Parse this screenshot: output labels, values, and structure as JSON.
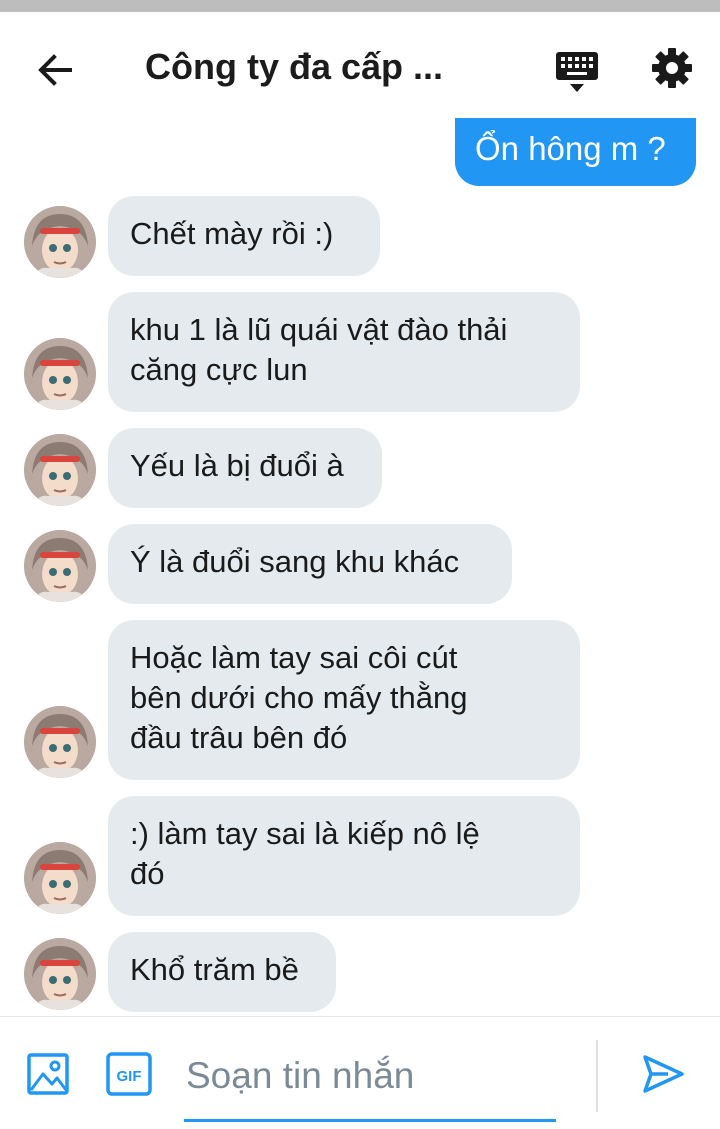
{
  "header": {
    "title": "Công ty đa cấp ...",
    "back_icon": "arrow-left-icon",
    "keyboard_icon": "keyboard-icon",
    "settings_icon": "gear-icon"
  },
  "colors": {
    "accent": "#2196f3",
    "incoming_bubble": "#e4eaee",
    "text": "#1a1a1a",
    "placeholder": "#7b8a96"
  },
  "outgoing_messages": [
    {
      "text": "Ổn hông m ?"
    }
  ],
  "incoming_messages": [
    {
      "lines": [
        "Chết mày rồi :)"
      ]
    },
    {
      "lines": [
        "khu 1 là lũ quái vật đào thải",
        "căng cực lun"
      ]
    },
    {
      "lines": [
        "Yếu là bị đuổi à"
      ]
    },
    {
      "lines": [
        "Ý là đuổi sang khu khác"
      ]
    },
    {
      "lines": [
        "Hoặc làm tay sai côi cút",
        "bên dưới cho mấy thằng",
        "đầu trâu bên đó"
      ]
    },
    {
      "lines": [
        ":) làm tay sai là kiếp nô lệ",
        "đó"
      ]
    },
    {
      "lines": [
        "Khổ trăm bề"
      ]
    }
  ],
  "composer": {
    "placeholder": "Soạn tin nhắn",
    "image_icon": "image-icon",
    "gif_label": "GIF",
    "send_icon": "send-icon"
  }
}
